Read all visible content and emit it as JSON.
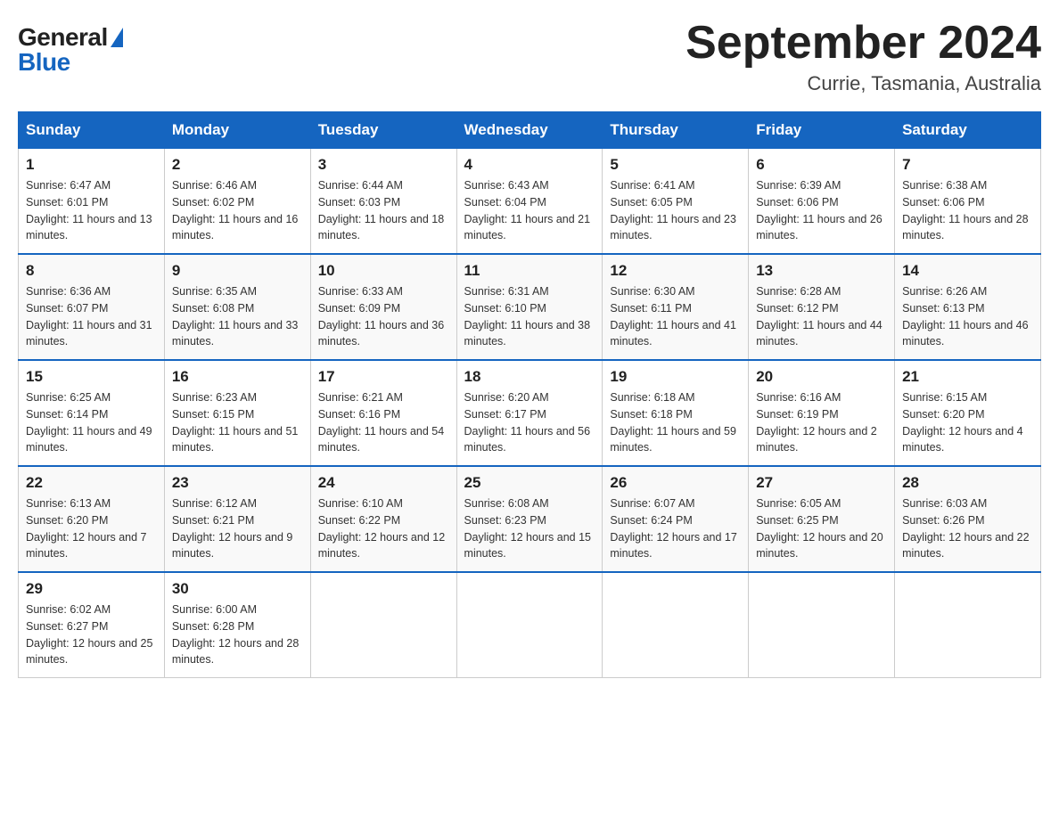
{
  "header": {
    "logo_general": "General",
    "logo_blue": "Blue",
    "month_title": "September 2024",
    "location": "Currie, Tasmania, Australia"
  },
  "weekdays": [
    "Sunday",
    "Monday",
    "Tuesday",
    "Wednesday",
    "Thursday",
    "Friday",
    "Saturday"
  ],
  "weeks": [
    [
      {
        "day": "1",
        "sunrise": "6:47 AM",
        "sunset": "6:01 PM",
        "daylight": "11 hours and 13 minutes."
      },
      {
        "day": "2",
        "sunrise": "6:46 AM",
        "sunset": "6:02 PM",
        "daylight": "11 hours and 16 minutes."
      },
      {
        "day": "3",
        "sunrise": "6:44 AM",
        "sunset": "6:03 PM",
        "daylight": "11 hours and 18 minutes."
      },
      {
        "day": "4",
        "sunrise": "6:43 AM",
        "sunset": "6:04 PM",
        "daylight": "11 hours and 21 minutes."
      },
      {
        "day": "5",
        "sunrise": "6:41 AM",
        "sunset": "6:05 PM",
        "daylight": "11 hours and 23 minutes."
      },
      {
        "day": "6",
        "sunrise": "6:39 AM",
        "sunset": "6:06 PM",
        "daylight": "11 hours and 26 minutes."
      },
      {
        "day": "7",
        "sunrise": "6:38 AM",
        "sunset": "6:06 PM",
        "daylight": "11 hours and 28 minutes."
      }
    ],
    [
      {
        "day": "8",
        "sunrise": "6:36 AM",
        "sunset": "6:07 PM",
        "daylight": "11 hours and 31 minutes."
      },
      {
        "day": "9",
        "sunrise": "6:35 AM",
        "sunset": "6:08 PM",
        "daylight": "11 hours and 33 minutes."
      },
      {
        "day": "10",
        "sunrise": "6:33 AM",
        "sunset": "6:09 PM",
        "daylight": "11 hours and 36 minutes."
      },
      {
        "day": "11",
        "sunrise": "6:31 AM",
        "sunset": "6:10 PM",
        "daylight": "11 hours and 38 minutes."
      },
      {
        "day": "12",
        "sunrise": "6:30 AM",
        "sunset": "6:11 PM",
        "daylight": "11 hours and 41 minutes."
      },
      {
        "day": "13",
        "sunrise": "6:28 AM",
        "sunset": "6:12 PM",
        "daylight": "11 hours and 44 minutes."
      },
      {
        "day": "14",
        "sunrise": "6:26 AM",
        "sunset": "6:13 PM",
        "daylight": "11 hours and 46 minutes."
      }
    ],
    [
      {
        "day": "15",
        "sunrise": "6:25 AM",
        "sunset": "6:14 PM",
        "daylight": "11 hours and 49 minutes."
      },
      {
        "day": "16",
        "sunrise": "6:23 AM",
        "sunset": "6:15 PM",
        "daylight": "11 hours and 51 minutes."
      },
      {
        "day": "17",
        "sunrise": "6:21 AM",
        "sunset": "6:16 PM",
        "daylight": "11 hours and 54 minutes."
      },
      {
        "day": "18",
        "sunrise": "6:20 AM",
        "sunset": "6:17 PM",
        "daylight": "11 hours and 56 minutes."
      },
      {
        "day": "19",
        "sunrise": "6:18 AM",
        "sunset": "6:18 PM",
        "daylight": "11 hours and 59 minutes."
      },
      {
        "day": "20",
        "sunrise": "6:16 AM",
        "sunset": "6:19 PM",
        "daylight": "12 hours and 2 minutes."
      },
      {
        "day": "21",
        "sunrise": "6:15 AM",
        "sunset": "6:20 PM",
        "daylight": "12 hours and 4 minutes."
      }
    ],
    [
      {
        "day": "22",
        "sunrise": "6:13 AM",
        "sunset": "6:20 PM",
        "daylight": "12 hours and 7 minutes."
      },
      {
        "day": "23",
        "sunrise": "6:12 AM",
        "sunset": "6:21 PM",
        "daylight": "12 hours and 9 minutes."
      },
      {
        "day": "24",
        "sunrise": "6:10 AM",
        "sunset": "6:22 PM",
        "daylight": "12 hours and 12 minutes."
      },
      {
        "day": "25",
        "sunrise": "6:08 AM",
        "sunset": "6:23 PM",
        "daylight": "12 hours and 15 minutes."
      },
      {
        "day": "26",
        "sunrise": "6:07 AM",
        "sunset": "6:24 PM",
        "daylight": "12 hours and 17 minutes."
      },
      {
        "day": "27",
        "sunrise": "6:05 AM",
        "sunset": "6:25 PM",
        "daylight": "12 hours and 20 minutes."
      },
      {
        "day": "28",
        "sunrise": "6:03 AM",
        "sunset": "6:26 PM",
        "daylight": "12 hours and 22 minutes."
      }
    ],
    [
      {
        "day": "29",
        "sunrise": "6:02 AM",
        "sunset": "6:27 PM",
        "daylight": "12 hours and 25 minutes."
      },
      {
        "day": "30",
        "sunrise": "6:00 AM",
        "sunset": "6:28 PM",
        "daylight": "12 hours and 28 minutes."
      },
      null,
      null,
      null,
      null,
      null
    ]
  ],
  "labels": {
    "sunrise": "Sunrise:",
    "sunset": "Sunset:",
    "daylight": "Daylight:"
  }
}
